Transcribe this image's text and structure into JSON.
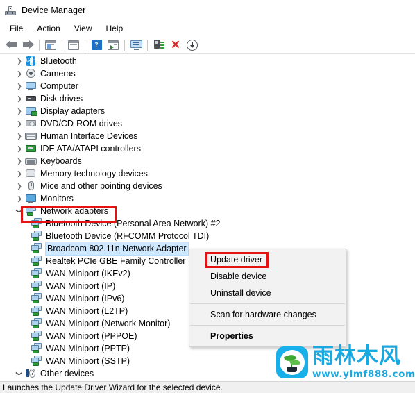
{
  "window": {
    "title": "Device Manager",
    "icon": "device-manager-icon"
  },
  "menubar": {
    "items": [
      {
        "label": "File"
      },
      {
        "label": "Action"
      },
      {
        "label": "View"
      },
      {
        "label": "Help"
      }
    ]
  },
  "toolbar": {
    "buttons": [
      {
        "name": "back-button",
        "icon": "back-arrow-icon"
      },
      {
        "name": "forward-button",
        "icon": "forward-arrow-icon"
      },
      {
        "name": "show-hide-console-tree-button",
        "icon": "console-tree-icon"
      },
      {
        "name": "properties-button",
        "icon": "properties-window-icon"
      },
      {
        "name": "help-button",
        "icon": "help-question-icon"
      },
      {
        "name": "show-hide-action-pane-button",
        "icon": "action-pane-icon"
      },
      {
        "name": "update-driver-button",
        "icon": "monitor-icon"
      },
      {
        "name": "scan-for-hardware-changes-button",
        "icon": "scan-hardware-icon"
      },
      {
        "name": "uninstall-device-button",
        "icon": "red-x-icon"
      },
      {
        "name": "disable-device-button",
        "icon": "download-arrow-icon"
      }
    ]
  },
  "tree": {
    "items": [
      {
        "label": "Bluetooth",
        "icon": "bluetooth-icon",
        "level": 0,
        "state": "collapsed"
      },
      {
        "label": "Cameras",
        "icon": "camera-icon",
        "level": 0,
        "state": "collapsed"
      },
      {
        "label": "Computer",
        "icon": "computer-icon",
        "level": 0,
        "state": "collapsed"
      },
      {
        "label": "Disk drives",
        "icon": "disk-drive-icon",
        "level": 0,
        "state": "collapsed"
      },
      {
        "label": "Display adapters",
        "icon": "display-adapter-icon",
        "level": 0,
        "state": "collapsed"
      },
      {
        "label": "DVD/CD-ROM drives",
        "icon": "dvd-drive-icon",
        "level": 0,
        "state": "collapsed"
      },
      {
        "label": "Human Interface Devices",
        "icon": "hid-icon",
        "level": 0,
        "state": "collapsed"
      },
      {
        "label": "IDE ATA/ATAPI controllers",
        "icon": "ide-controller-icon",
        "level": 0,
        "state": "collapsed"
      },
      {
        "label": "Keyboards",
        "icon": "keyboard-icon",
        "level": 0,
        "state": "collapsed"
      },
      {
        "label": "Memory technology devices",
        "icon": "memory-icon",
        "level": 0,
        "state": "collapsed"
      },
      {
        "label": "Mice and other pointing devices",
        "icon": "mouse-icon",
        "level": 0,
        "state": "collapsed"
      },
      {
        "label": "Monitors",
        "icon": "monitor-icon",
        "level": 0,
        "state": "collapsed"
      },
      {
        "label": "Network adapters",
        "icon": "network-adapter-icon",
        "level": 0,
        "state": "expanded",
        "highlighted": true
      },
      {
        "label": "Bluetooth Device (Personal Area Network) #2",
        "icon": "network-adapter-icon",
        "level": 1,
        "state": "leaf"
      },
      {
        "label": "Bluetooth Device (RFCOMM Protocol TDI)",
        "icon": "network-adapter-icon",
        "level": 1,
        "state": "leaf"
      },
      {
        "label": "Broadcom 802.11n Network Adapter",
        "icon": "network-adapter-icon",
        "level": 1,
        "state": "leaf",
        "selected": true
      },
      {
        "label": "Realtek PCIe GBE Family Controller",
        "icon": "network-adapter-icon",
        "level": 1,
        "state": "leaf"
      },
      {
        "label": "WAN Miniport (IKEv2)",
        "icon": "network-adapter-icon",
        "level": 1,
        "state": "leaf"
      },
      {
        "label": "WAN Miniport (IP)",
        "icon": "network-adapter-icon",
        "level": 1,
        "state": "leaf"
      },
      {
        "label": "WAN Miniport (IPv6)",
        "icon": "network-adapter-icon",
        "level": 1,
        "state": "leaf"
      },
      {
        "label": "WAN Miniport (L2TP)",
        "icon": "network-adapter-icon",
        "level": 1,
        "state": "leaf"
      },
      {
        "label": "WAN Miniport (Network Monitor)",
        "icon": "network-adapter-icon",
        "level": 1,
        "state": "leaf"
      },
      {
        "label": "WAN Miniport (PPPOE)",
        "icon": "network-adapter-icon",
        "level": 1,
        "state": "leaf"
      },
      {
        "label": "WAN Miniport (PPTP)",
        "icon": "network-adapter-icon",
        "level": 1,
        "state": "leaf"
      },
      {
        "label": "WAN Miniport (SSTP)",
        "icon": "network-adapter-icon",
        "level": 1,
        "state": "leaf"
      },
      {
        "label": "Other devices",
        "icon": "other-devices-warning-icon",
        "level": 0,
        "state": "expanded"
      }
    ]
  },
  "context_menu": {
    "items": [
      {
        "label": "Update driver",
        "bold": false,
        "highlighted": true
      },
      {
        "label": "Disable device",
        "bold": false
      },
      {
        "label": "Uninstall device",
        "bold": false
      },
      {
        "separator": true
      },
      {
        "label": "Scan for hardware changes",
        "bold": false
      },
      {
        "separator": true
      },
      {
        "label": "Properties",
        "bold": true
      }
    ]
  },
  "statusbar": {
    "text": "Launches the Update Driver Wizard for the selected device."
  },
  "watermark": {
    "brand_cn": "雨林木风",
    "url": "www.ylmf888.com",
    "color": "#1aa8e0"
  },
  "colors": {
    "annotation_red": "#e51212",
    "selection_blue": "#cde8ff",
    "accent": "#1aa8e0"
  }
}
